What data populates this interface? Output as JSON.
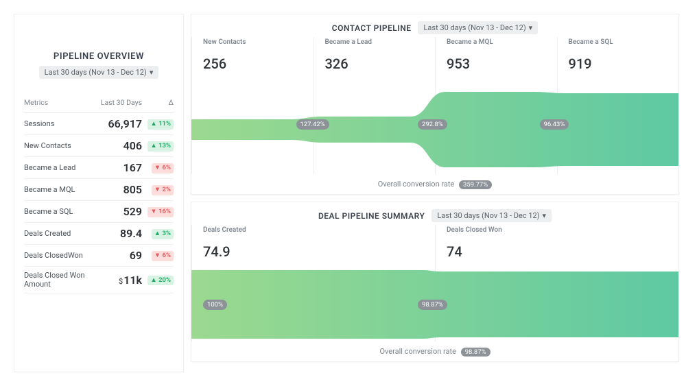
{
  "date_range_label": "Last 30 days (Nov 13 - Dec 12)",
  "sidebar": {
    "title": "PIPELINE OVERVIEW",
    "col_metric": "Metrics",
    "col_period": "Last 30 Days",
    "col_delta": "Δ",
    "rows": [
      {
        "metric": "Sessions",
        "value": "66,917",
        "delta": "11%",
        "dir": "up"
      },
      {
        "metric": "New Contacts",
        "value": "406",
        "delta": "13%",
        "dir": "up"
      },
      {
        "metric": "Became a Lead",
        "value": "167",
        "delta": "6%",
        "dir": "down"
      },
      {
        "metric": "Became a MQL",
        "value": "805",
        "delta": "2%",
        "dir": "down"
      },
      {
        "metric": "Became a SQL",
        "value": "529",
        "delta": "16%",
        "dir": "down"
      },
      {
        "metric": "Deals Created",
        "value": "89.4",
        "delta": "3%",
        "dir": "up"
      },
      {
        "metric": "Deals ClosedWon",
        "value": "69",
        "delta": "6%",
        "dir": "down"
      },
      {
        "metric": "Deals Closed Won Amount",
        "value": "11k",
        "prefix": "$",
        "delta": "20%",
        "dir": "up"
      }
    ]
  },
  "contact": {
    "title": "CONTACT PIPELINE",
    "overall_label": "Overall conversion rate",
    "overall_rate": "359.77%",
    "stages": [
      {
        "label": "New Contacts",
        "value": "256"
      },
      {
        "label": "Became a Lead",
        "value": "326",
        "conv": "127.42%"
      },
      {
        "label": "Became a MQL",
        "value": "953",
        "conv": "292.8%"
      },
      {
        "label": "Became a SQL",
        "value": "919",
        "conv": "96.43%"
      }
    ]
  },
  "deal": {
    "title": "DEAL PIPELINE SUMMARY",
    "overall_label": "Overall conversion rate",
    "overall_rate": "98.87%",
    "stages": [
      {
        "label": "Deals Created",
        "value": "74.9",
        "conv": "100%"
      },
      {
        "label": "Deals Closed Won",
        "value": "74",
        "conv": "98.87%"
      }
    ]
  },
  "chart_data": [
    {
      "type": "funnel",
      "title": "CONTACT PIPELINE",
      "categories": [
        "New Contacts",
        "Became a Lead",
        "Became a MQL",
        "Became a SQL"
      ],
      "values": [
        256,
        326,
        953,
        919
      ],
      "stage_conversion_pct": [
        null,
        127.42,
        292.8,
        96.43
      ],
      "overall_conversion_pct": 359.77
    },
    {
      "type": "funnel",
      "title": "DEAL PIPELINE SUMMARY",
      "categories": [
        "Deals Created",
        "Deals Closed Won"
      ],
      "values": [
        74.9,
        74
      ],
      "stage_conversion_pct": [
        100,
        98.87
      ],
      "overall_conversion_pct": 98.87
    }
  ]
}
